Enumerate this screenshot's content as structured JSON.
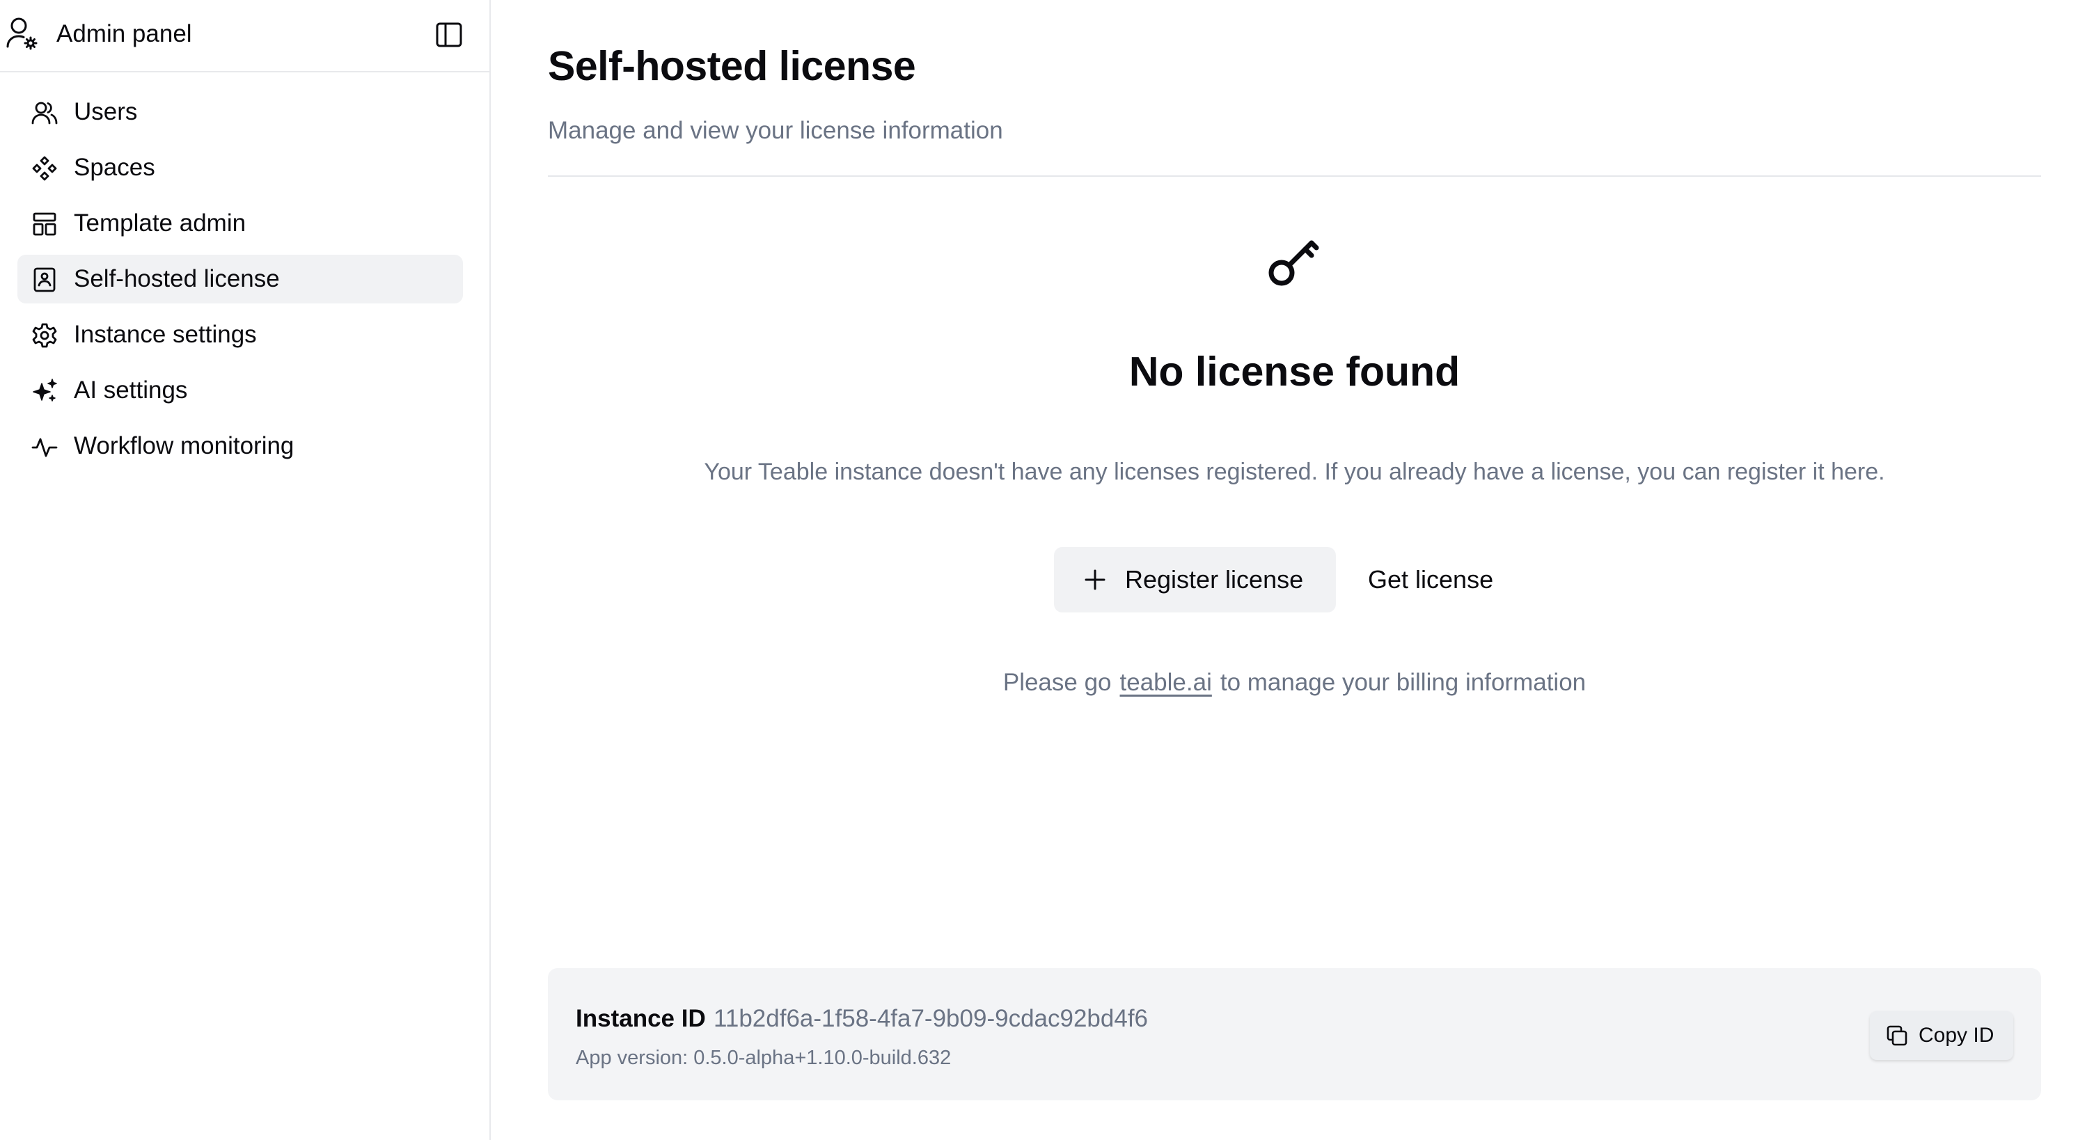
{
  "sidebar": {
    "title": "Admin panel",
    "header_icon": "user-settings-icon",
    "toggle_icon": "sidebar-toggle-icon",
    "items": [
      {
        "label": "Users",
        "icon": "users-icon",
        "active": false
      },
      {
        "label": "Spaces",
        "icon": "spaces-icon",
        "active": false
      },
      {
        "label": "Template admin",
        "icon": "template-icon",
        "active": false
      },
      {
        "label": "Self-hosted license",
        "icon": "license-icon",
        "active": true
      },
      {
        "label": "Instance settings",
        "icon": "gear-icon",
        "active": false
      },
      {
        "label": "AI settings",
        "icon": "sparkles-icon",
        "active": false
      },
      {
        "label": "Workflow monitoring",
        "icon": "activity-icon",
        "active": false
      }
    ]
  },
  "main": {
    "title": "Self-hosted license",
    "subtitle": "Manage and view your license information",
    "empty_state": {
      "icon": "key-icon",
      "title": "No license found",
      "description": "Your Teable instance doesn't have any licenses registered. If you already have a license, you can register it here."
    },
    "actions": {
      "register_label": "Register license",
      "get_label": "Get license"
    },
    "billing": {
      "prefix": "Please go",
      "link": "teable.ai",
      "suffix": "to manage your billing information"
    },
    "instance": {
      "label": "Instance ID",
      "id": "11b2df6a-1f58-4fa7-9b09-9cdac92bd4f6",
      "version_label": "App version:",
      "version": "0.5.0-alpha+1.10.0-build.632",
      "copy_label": "Copy ID"
    }
  },
  "colors": {
    "text": "#0b0b0f",
    "muted": "#6a7384",
    "active_bg": "#f1f2f4",
    "card_bg": "#f3f4f6",
    "border": "#e8e9ec"
  }
}
